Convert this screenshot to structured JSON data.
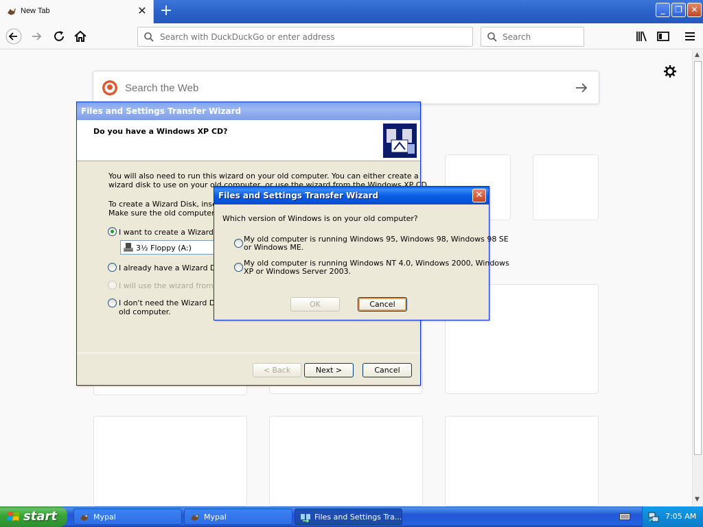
{
  "browser": {
    "tab_title": "New Tab",
    "tab_close": "✕",
    "new_tab": "+",
    "url_placeholder": "Search with DuckDuckGo or enter address",
    "search_placeholder": "Search"
  },
  "newtab_page": {
    "search_placeholder": "Search the Web"
  },
  "wizard_main": {
    "title": "Files and Settings Transfer Wizard",
    "heading": "Do you have a Windows XP CD?",
    "para1_line1": "You will also need to run this wizard on your old computer. You can either create a",
    "para1_line2": "wizard disk to use on your old computer, or use the wizard from the Windows XP CD.",
    "para2_line1": "To create a Wizard Disk, insert a",
    "para2_line2": "Make sure the old computer has",
    "option1": "I want to create a Wizard Dis",
    "drive": "3½ Floppy (A:)",
    "option2": "I already have a Wizard Disk.",
    "option3": "I will use the wizard from the W",
    "option4_line1": "I don't need the Wizard Disk.",
    "option4_line2": "old computer.",
    "back": "< Back",
    "next": "Next >",
    "cancel": "Cancel"
  },
  "wizard_popup": {
    "title": "Files and Settings Transfer Wizard",
    "close": "✕",
    "question": "Which version of Windows is on your old computer?",
    "opt1_line1": "My old computer is running Windows 95, Windows 98, Windows 98 SE",
    "opt1_line2": "or Windows ME.",
    "opt2_line1": "My old computer is running Windows NT 4.0, Windows 2000, Windows",
    "opt2_line2": "XP or Windows Server 2003.",
    "ok": "OK",
    "cancel": "Cancel"
  },
  "taskbar": {
    "start": "start",
    "tasks": [
      {
        "label": "Mypal"
      },
      {
        "label": "Mypal"
      },
      {
        "label": "Files and Settings Tra..."
      }
    ],
    "clock": "7:05 AM"
  },
  "colors": {
    "xp_title_blue": "#0653d8",
    "taskbar_blue": "#2157d7",
    "start_green": "#37a337",
    "radio_checked": "#21a121"
  }
}
